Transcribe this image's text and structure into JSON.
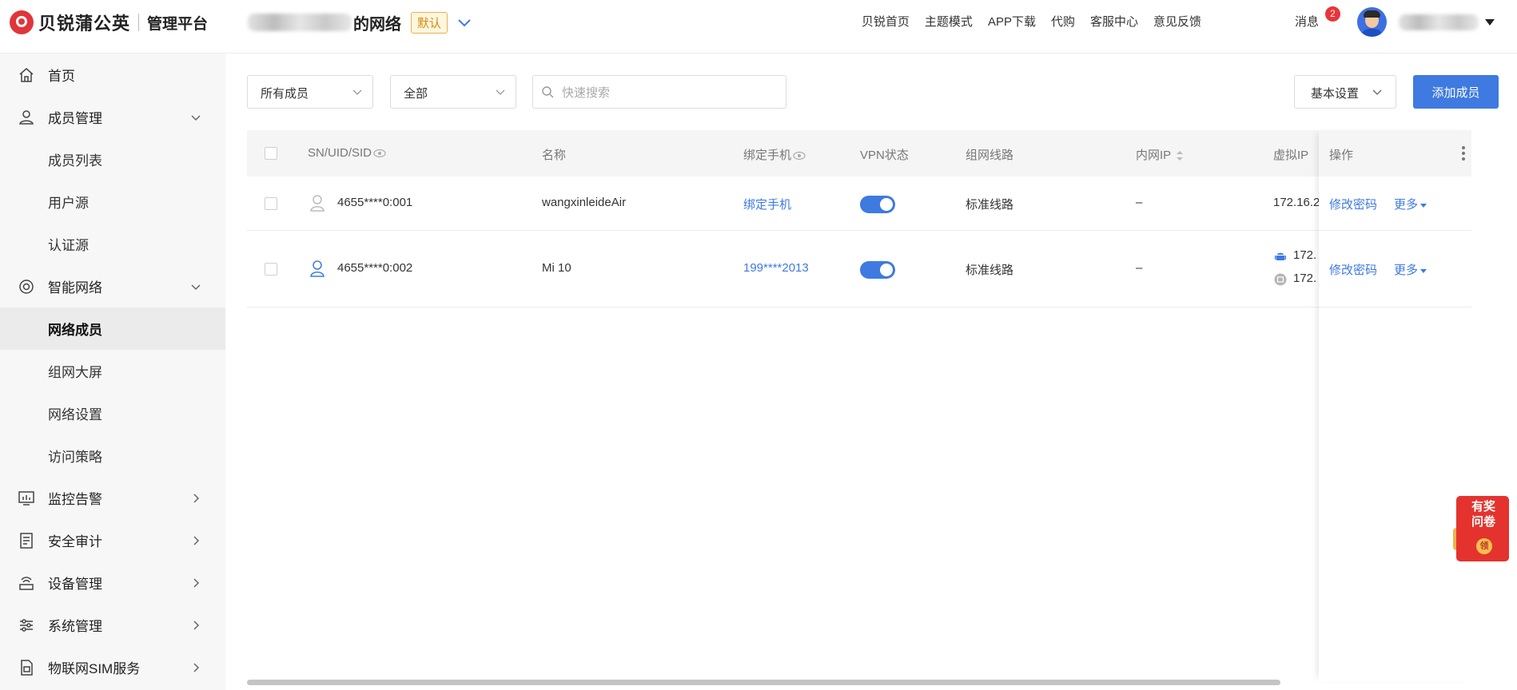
{
  "brand": {
    "name": "贝锐蒲公英",
    "subtitle": "管理平台"
  },
  "network": {
    "title_suffix": "的网络",
    "default_badge": "默认"
  },
  "top_links": [
    "贝锐首页",
    "主题模式",
    "APP下载",
    "代购",
    "客服中心",
    "意见反馈"
  ],
  "messages": {
    "label": "消息",
    "count": "2"
  },
  "sidebar": {
    "items": [
      {
        "label": "首页",
        "icon": "home-icon"
      },
      {
        "label": "成员管理",
        "icon": "user-icon",
        "arrow": "down"
      },
      {
        "label": "成员列表",
        "sub": true
      },
      {
        "label": "用户源",
        "sub": true
      },
      {
        "label": "认证源",
        "sub": true
      },
      {
        "label": "智能网络",
        "icon": "network-icon",
        "arrow": "down"
      },
      {
        "label": "网络成员",
        "sub": true,
        "active": true
      },
      {
        "label": "组网大屏",
        "sub": true
      },
      {
        "label": "网络设置",
        "sub": true
      },
      {
        "label": "访问策略",
        "sub": true
      },
      {
        "label": "监控告警",
        "icon": "monitor-icon",
        "arrow": "right"
      },
      {
        "label": "安全审计",
        "icon": "audit-icon",
        "arrow": "right"
      },
      {
        "label": "设备管理",
        "icon": "device-icon",
        "arrow": "right"
      },
      {
        "label": "系统管理",
        "icon": "settings-sliders-icon",
        "arrow": "right"
      },
      {
        "label": "物联网SIM服务",
        "icon": "sim-icon",
        "arrow": "right"
      }
    ]
  },
  "filters": {
    "member_select": "所有成员",
    "status_select": "全部",
    "search_placeholder": "快速搜索",
    "settings_label": "基本设置",
    "add_label": "添加成员"
  },
  "table": {
    "columns": {
      "sn": "SN/UID/SID",
      "name": "名称",
      "phone": "绑定手机",
      "vpn": "VPN状态",
      "route": "组网线路",
      "lan_ip": "内网IP",
      "virtual_ip": "虚拟IP",
      "ops": "操作"
    },
    "rows": [
      {
        "sn": "4655****0:001",
        "name": "wangxinleideAir",
        "phone": "绑定手机",
        "vpn_on": true,
        "route": "标准线路",
        "lan_ip": "–",
        "virtual_ip": "172.16.2"
      },
      {
        "sn": "4655****0:002",
        "name": "Mi 10",
        "phone": "199****2013",
        "vpn_on": true,
        "route": "标准线路",
        "lan_ip": "–",
        "virtual_ip_1": "172.",
        "virtual_ip_2": "172."
      }
    ],
    "op_edit": "修改密码",
    "op_more": "更多"
  },
  "survey": {
    "line1": "有奖",
    "line2": "问卷",
    "coin": "领"
  },
  "colors": {
    "accent": "#3e7ae0",
    "brand": "#e0353a",
    "badge": "#e8343a"
  }
}
